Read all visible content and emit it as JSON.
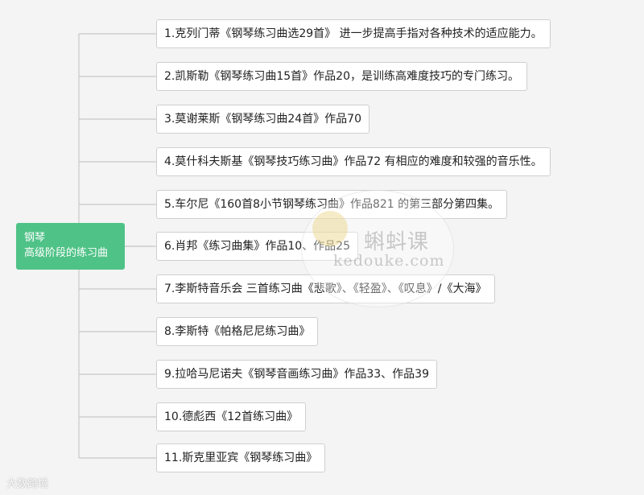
{
  "root": {
    "line1": "钢琴",
    "line2": "高级阶段的练习曲"
  },
  "topics": [
    "1.克列门蒂《钢琴练习曲选29首》 进一步提高手指对各种技术的适应能力。",
    "2.凯斯勒《钢琴练习曲15首》作品20，是训练高难度技巧的专门练习。",
    "3.莫谢莱斯《钢琴练习曲24首》作品70",
    "4.莫什科夫斯基《钢琴技巧练习曲》作品72 有相应的难度和较强的音乐性。",
    "5.车尔尼《160首8小节钢琴练习曲》作品821 的第三部分第四集。",
    "6.肖邦《练习曲集》作品10、作品25",
    "7.李斯特音乐会 三首练习曲《悲歌》、《轻盈》、《叹息》/《大海》",
    "8.李斯特《帕格尼尼练习曲》",
    "9.拉哈马尼诺夫《钢琴音画练习曲》作品33、作品39",
    "10.德彪西《12首练习曲》",
    "11.斯克里亚宾《钢琴练习曲》"
  ],
  "watermark": {
    "center_cn": "蝌蚪课",
    "center_en": "kedouke.com",
    "bottom": "大数跨境"
  },
  "colors": {
    "root_bg": "#4fc287",
    "link": "#c8c8c8"
  }
}
